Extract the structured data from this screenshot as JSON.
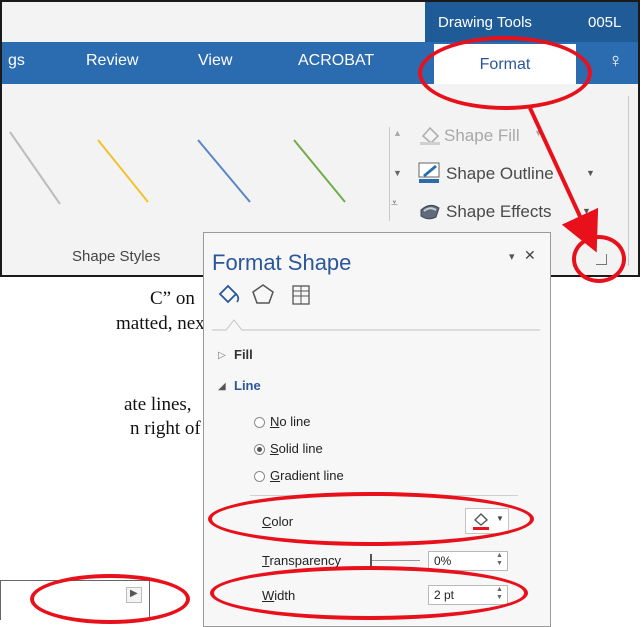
{
  "ribbon": {
    "contextual_title": "Drawing Tools",
    "doc_title": "005L",
    "tabs": [
      "gs",
      "Review",
      "View",
      "ACROBAT"
    ],
    "active_tab": "Format",
    "lightbulb": "♀",
    "shape_fill": "Shape Fill",
    "shape_outline": "Shape Outline",
    "shape_effects": "Shape Effects",
    "group_label": "Shape Styles",
    "style_colors": [
      "#bdbdbd",
      "#f2c12e",
      "#5a86c8",
      "#70ad47"
    ]
  },
  "doc_text": {
    "line1": "C” on",
    "line2": "matted, next",
    "line3": "ate  lines,",
    "line4": "n right of the"
  },
  "pane": {
    "title": "Format Shape",
    "pin": "▾",
    "close": "✕",
    "fill": "Fill",
    "line": "Line",
    "no_line_u": "N",
    "no_line_rest": "o line",
    "solid_u": "S",
    "solid_rest": "olid line",
    "gradient_u": "G",
    "gradient_rest": "radient line",
    "color_u": "C",
    "color_rest": "olor",
    "transparency_u": "T",
    "transparency_rest": "ransparency",
    "transparency_value": "0%",
    "width_u": "W",
    "width_rest": "idth",
    "width_value": "2 pt"
  },
  "annotation_color": "#e8101a"
}
